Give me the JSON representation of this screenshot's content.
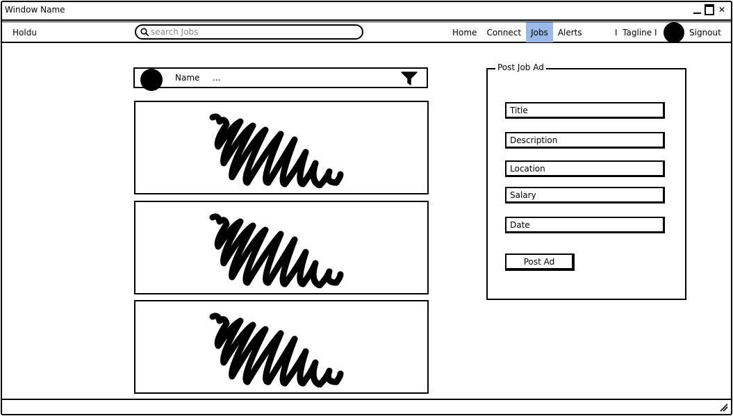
{
  "window": {
    "title": "Window Name",
    "close_glyph": "✕"
  },
  "nav": {
    "brand": "Holdu",
    "search_placeholder": "search Jobs",
    "links": [
      "Home",
      "Connect",
      "Jobs",
      "Alerts"
    ],
    "active_link": "Jobs",
    "tagline": "I  Tagline I",
    "signout": "Signout"
  },
  "feed": {
    "header_name": "Name",
    "header_more": "...",
    "cards_count": 3
  },
  "post_form": {
    "legend": "Post Job Ad",
    "fields": {
      "title": "Title",
      "description": "Description",
      "location": "Location",
      "salary": "Salary",
      "date": "Date"
    },
    "submit_label": "Post Ad"
  },
  "colors": {
    "active_tab": "#9ab9e8"
  },
  "icons": [
    "search-icon",
    "filter-icon",
    "scribble-image-icon",
    "resize-grip-icon"
  ]
}
